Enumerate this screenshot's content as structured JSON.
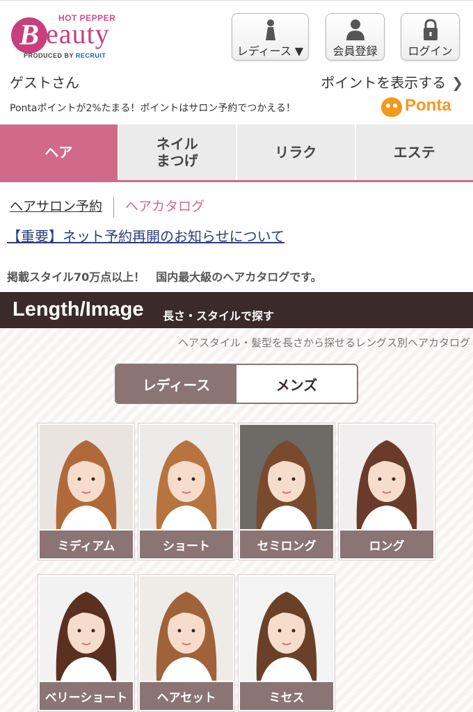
{
  "header": {
    "logo": {
      "top": "HOT PEPPER",
      "b": "B",
      "word": "eauty",
      "produced": "PRODUCED BY",
      "recruit": "RECRUIT"
    },
    "buttons": {
      "ladies": "レディース ▼",
      "member": "会員登録",
      "login": "ログイン"
    }
  },
  "user": {
    "guest": "ゲストさん",
    "points_link": "ポイントを表示する",
    "ponta_note": "Pontaポイントが2%たまる！ポイントはサロン予約でつかえる！",
    "ponta_brand": "Ponta"
  },
  "tabs": [
    {
      "label": "ヘア",
      "active": true
    },
    {
      "label": "ネイル\nまつげ",
      "active": false
    },
    {
      "label": "リラク",
      "active": false
    },
    {
      "label": "エステ",
      "active": false
    }
  ],
  "subnav": {
    "salon": "ヘアサロン予約",
    "catalog": "ヘアカタログ"
  },
  "notice": "【重要】ネット予約再開のお知らせについて",
  "lead": "掲載スタイル70万点以上！　国内最大級のヘアカタログです。",
  "section": {
    "title_en": "Length/Image",
    "title_jp": "長さ・スタイルで探す",
    "subtitle": "ヘアスタイル・髪型を長さから探せるレングス別ヘアカタログ"
  },
  "gender_toggle": {
    "ladies": "レディース",
    "mens": "メンズ",
    "selected": "ladies"
  },
  "styles": [
    {
      "label": "ミディアム",
      "hair": "#b06a3a",
      "bg": "#e9e4e0"
    },
    {
      "label": "ショート",
      "hair": "#b8743e",
      "bg": "#ecebea"
    },
    {
      "label": "セミロング",
      "hair": "#7a4a2c",
      "bg": "#6e6a66"
    },
    {
      "label": "ロング",
      "hair": "#6a3a2a",
      "bg": "#f0eeee"
    },
    {
      "label": "ベリーショート",
      "hair": "#5a3020",
      "bg": "#f2f2f2"
    },
    {
      "label": "ヘアセット",
      "hair": "#a0623a",
      "bg": "#efece8"
    },
    {
      "label": "ミセス",
      "hair": "#6b4028",
      "bg": "#f3f3f3"
    }
  ]
}
